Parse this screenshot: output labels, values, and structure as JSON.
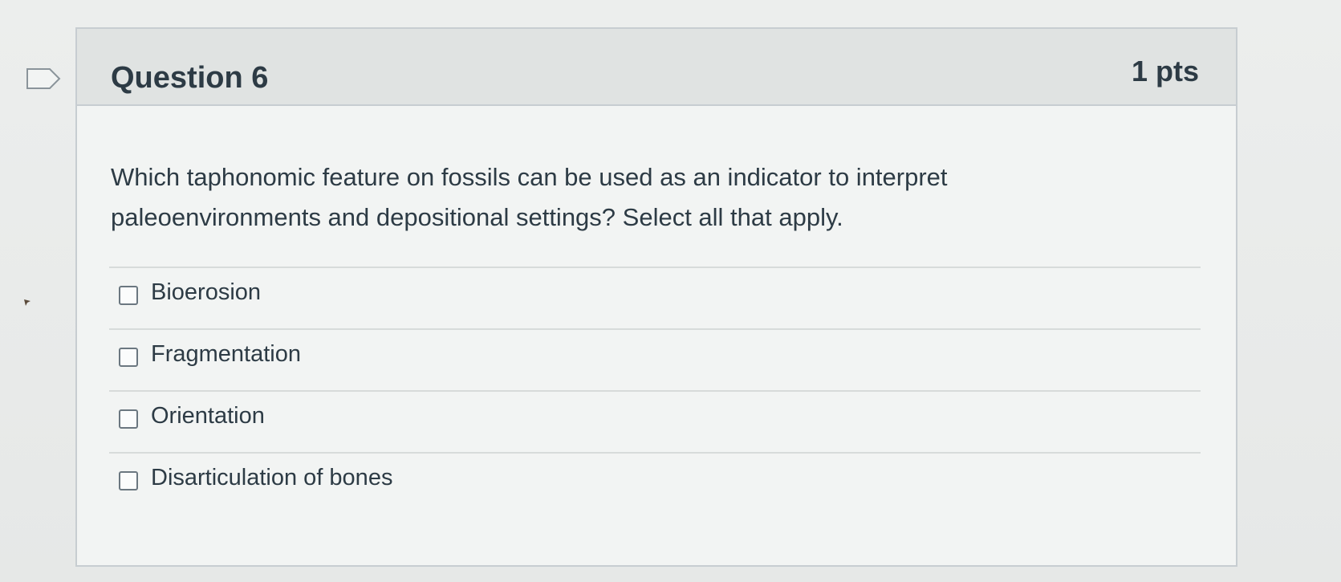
{
  "question": {
    "title": "Question 6",
    "points": "1 pts",
    "text": "Which taphonomic feature on fossils can be used as an indicator to interpret paleoenvironments and depositional settings? Select all that apply."
  },
  "answers": [
    {
      "label": "Bioerosion",
      "checked": false
    },
    {
      "label": "Fragmentation",
      "checked": false
    },
    {
      "label": "Orientation",
      "checked": false
    },
    {
      "label": "Disarticulation of bones",
      "checked": false
    }
  ],
  "icons": {
    "flag": "flag-icon"
  },
  "colors": {
    "text": "#2d3b45",
    "header_bg": "#e0e3e2",
    "border": "#c7cdd1"
  }
}
